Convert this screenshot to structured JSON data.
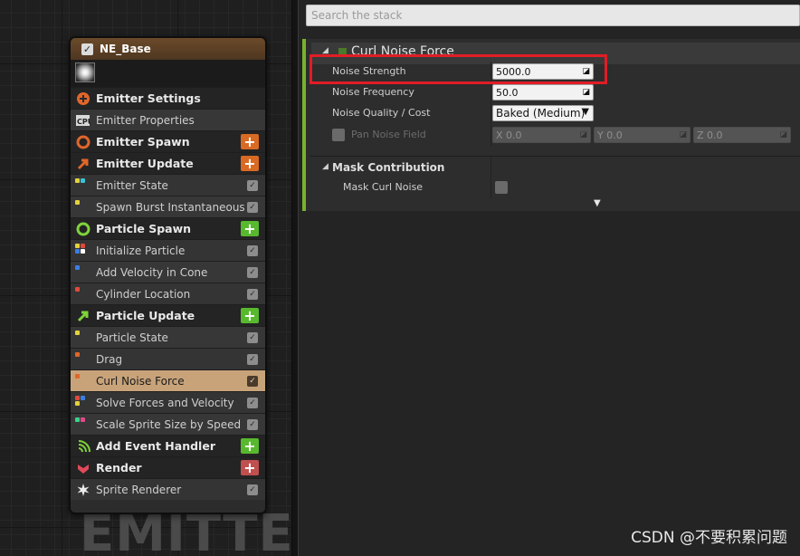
{
  "emitter": {
    "name": "NE_Base",
    "watermark": "EMITTER",
    "rows": [
      {
        "type": "section",
        "label": "Emitter Settings",
        "icon": "emitter-settings-icon",
        "color": "#e0662a"
      },
      {
        "type": "module",
        "label": "Emitter Properties",
        "icon": "cpu-icon"
      },
      {
        "type": "section",
        "label": "Emitter Spawn",
        "icon": "emitter-spawn-icon",
        "color": "#e0662a",
        "add": "orange"
      },
      {
        "type": "section",
        "label": "Emitter Update",
        "icon": "emitter-update-icon",
        "color": "#e0662a",
        "add": "orange"
      },
      {
        "type": "module",
        "label": "Emitter State",
        "dots": [
          "#e5d13c",
          "#37c3d4"
        ],
        "check": true
      },
      {
        "type": "module",
        "label": "Spawn Burst Instantaneous",
        "dots": [
          "#e5d13c"
        ],
        "check": true
      },
      {
        "type": "section",
        "label": "Particle Spawn",
        "icon": "particle-spawn-icon",
        "color": "#7ed33b",
        "add": "green"
      },
      {
        "type": "module",
        "label": "Initialize Particle",
        "dots": [
          "#e5d13c",
          "#e04a3c",
          "#3c7ee0",
          "#ffffff"
        ],
        "check": true
      },
      {
        "type": "module",
        "label": "Add Velocity in Cone",
        "dots": [
          "#3c7ee0"
        ],
        "check": true
      },
      {
        "type": "module",
        "label": "Cylinder Location",
        "dots": [
          "#e04a3c"
        ],
        "check": true
      },
      {
        "type": "section",
        "label": "Particle Update",
        "icon": "particle-update-icon",
        "color": "#7ed33b",
        "add": "green"
      },
      {
        "type": "module",
        "label": "Particle State",
        "dots": [
          "#e5d13c"
        ],
        "check": true
      },
      {
        "type": "module",
        "label": "Drag",
        "dots": [
          "#e0662a"
        ],
        "check": true
      },
      {
        "type": "module",
        "label": "Curl Noise Force",
        "dots": [
          "#e0662a"
        ],
        "check": true,
        "selected": true
      },
      {
        "type": "module",
        "label": "Solve Forces and Velocity",
        "dots": [
          "#e04a3c",
          "#3c7ee0",
          "#e5d13c"
        ],
        "check": true
      },
      {
        "type": "module",
        "label": "Scale Sprite Size by Speed",
        "dots": [
          "#37d48a",
          "#e04a8a"
        ],
        "check": true
      },
      {
        "type": "section",
        "label": "Add Event Handler",
        "icon": "event-handler-icon",
        "color": "#7ed33b",
        "add": "green"
      },
      {
        "type": "section",
        "label": "Render",
        "icon": "render-icon",
        "color": "#e04a5a",
        "add": "red"
      },
      {
        "type": "module",
        "label": "Sprite Renderer",
        "icon": "sprite-icon",
        "check": true
      }
    ]
  },
  "stack": {
    "search_placeholder": "Search the stack",
    "module_title": "Curl Noise Force",
    "accent_color": "#77b32c",
    "props": {
      "noise_strength_label": "Noise Strength",
      "noise_strength_value": "5000.0",
      "noise_frequency_label": "Noise Frequency",
      "noise_frequency_value": "50.0",
      "noise_quality_label": "Noise Quality / Cost",
      "noise_quality_value": "Baked (Medium)",
      "pan_noise_label": "Pan Noise Field",
      "pan_x": "X 0.0",
      "pan_y": "Y 0.0",
      "pan_z": "Z 0.0"
    },
    "mask_section_title": "Mask Contribution",
    "mask_curl_label": "Mask Curl Noise",
    "highlight_color": "#e01d26"
  },
  "watermark": "CSDN @不要积累问题"
}
